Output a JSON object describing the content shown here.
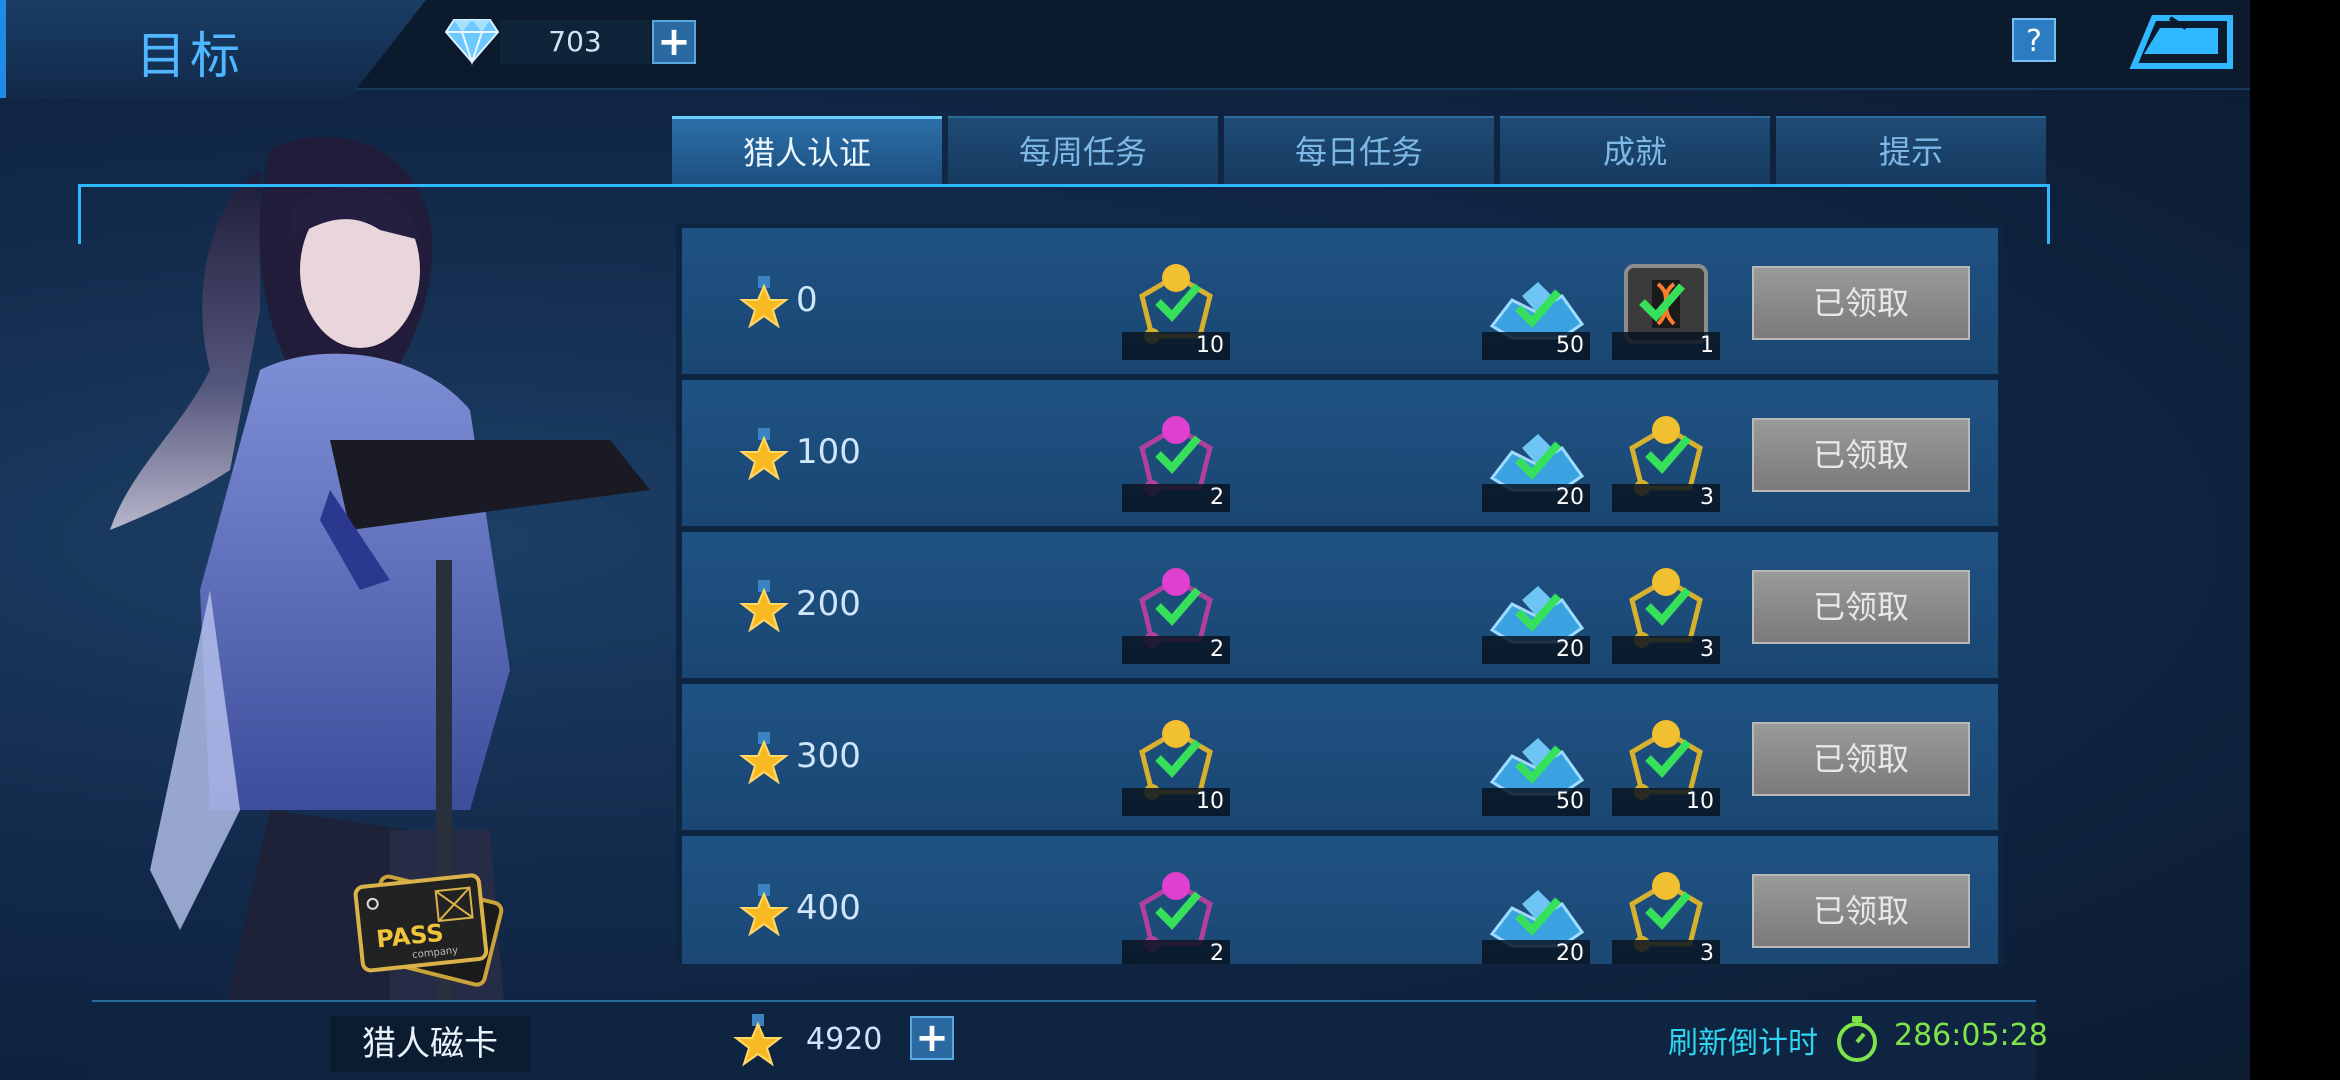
{
  "header": {
    "title": "目标",
    "gem_count": "703",
    "add_symbol": "+",
    "help_symbol": "?"
  },
  "tabs": [
    {
      "label": "猎人认证",
      "active": true
    },
    {
      "label": "每周任务",
      "active": false
    },
    {
      "label": "每日任务",
      "active": false
    },
    {
      "label": "成就",
      "active": false
    },
    {
      "label": "提示",
      "active": false
    }
  ],
  "rows": [
    {
      "level": "0",
      "rewards": [
        {
          "icon": "gold-orb-icon",
          "count": "10"
        },
        {
          "icon": "diamond-pile-icon",
          "count": "50"
        },
        {
          "icon": "dna-crate-icon",
          "count": "1"
        }
      ],
      "button": "已领取"
    },
    {
      "level": "100",
      "rewards": [
        {
          "icon": "purple-orb-icon",
          "count": "2"
        },
        {
          "icon": "diamond-pile-icon",
          "count": "20"
        },
        {
          "icon": "gold-orb-icon",
          "count": "3"
        }
      ],
      "button": "已领取"
    },
    {
      "level": "200",
      "rewards": [
        {
          "icon": "purple-orb-icon",
          "count": "2"
        },
        {
          "icon": "diamond-pile-icon",
          "count": "20"
        },
        {
          "icon": "gold-orb-icon",
          "count": "3"
        }
      ],
      "button": "已领取"
    },
    {
      "level": "300",
      "rewards": [
        {
          "icon": "gold-orb-icon",
          "count": "10"
        },
        {
          "icon": "diamond-pile-icon",
          "count": "50"
        },
        {
          "icon": "gold-orb-icon",
          "count": "10"
        }
      ],
      "button": "已领取"
    },
    {
      "level": "400",
      "rewards": [
        {
          "icon": "purple-orb-icon",
          "count": "2"
        },
        {
          "icon": "diamond-pile-icon",
          "count": "20"
        },
        {
          "icon": "gold-orb-icon",
          "count": "3"
        }
      ],
      "button": "已领取"
    }
  ],
  "pass_card": {
    "label": "猎人磁卡",
    "card_text": "PASS",
    "card_subtext": "company"
  },
  "footer": {
    "points": "4920",
    "refresh_label": "刷新倒计时",
    "timer": "286:05:28"
  },
  "colors": {
    "accent": "#2fb8ff",
    "timer": "#7fe34a",
    "refresh": "#2fd5f0"
  }
}
